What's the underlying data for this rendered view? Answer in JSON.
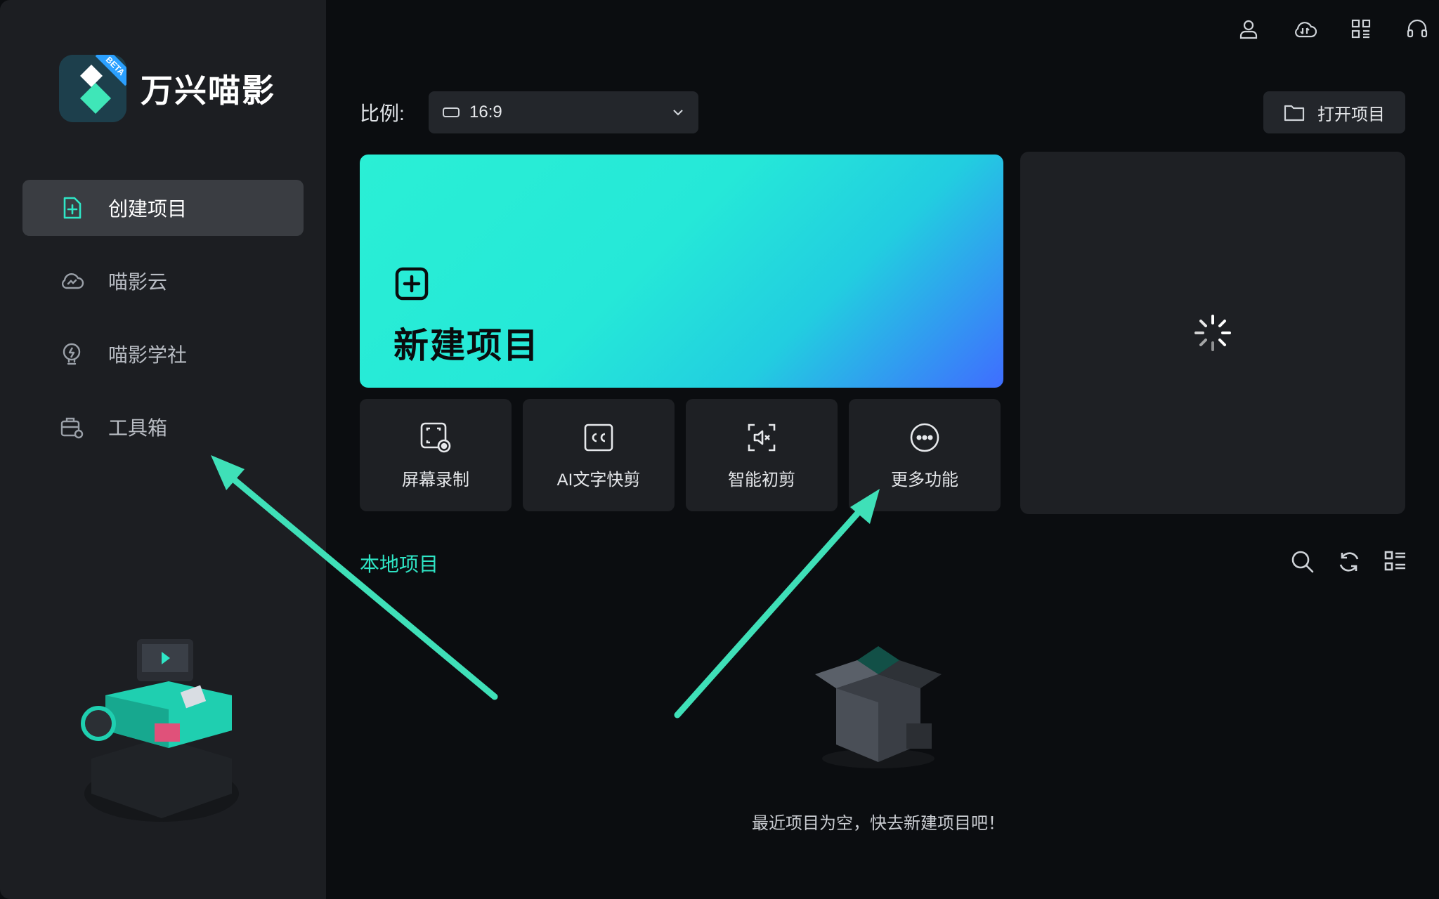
{
  "app": {
    "name": "万兴喵影",
    "badge": "BETA"
  },
  "sidebar": {
    "items": [
      {
        "label": "创建项目",
        "icon": "create-project-icon",
        "active": true
      },
      {
        "label": "喵影云",
        "icon": "cloud-icon",
        "active": false
      },
      {
        "label": "喵影学社",
        "icon": "lightbulb-icon",
        "active": false
      },
      {
        "label": "工具箱",
        "icon": "toolbox-icon",
        "active": false
      }
    ]
  },
  "top_icons": [
    "user-icon",
    "cloud-sync-icon",
    "apps-grid-icon",
    "headset-icon"
  ],
  "ratio": {
    "label": "比例:",
    "value": "16:9"
  },
  "open_project": {
    "label": "打开项目"
  },
  "hero": {
    "title": "新建项目"
  },
  "tools": [
    {
      "label": "屏幕录制",
      "icon": "screen-record-icon"
    },
    {
      "label": "AI文字快剪",
      "icon": "cc-icon"
    },
    {
      "label": "智能初剪",
      "icon": "smart-cut-icon"
    },
    {
      "label": "更多功能",
      "icon": "more-icon"
    }
  ],
  "local": {
    "title": "本地项目",
    "empty_text": "最近项目为空，快去新建项目吧！"
  },
  "colors": {
    "accent": "#2fe6c6",
    "arrow": "#3fe0b8",
    "sidebar_bg": "#1c1e22",
    "main_bg": "#0b0d10"
  }
}
